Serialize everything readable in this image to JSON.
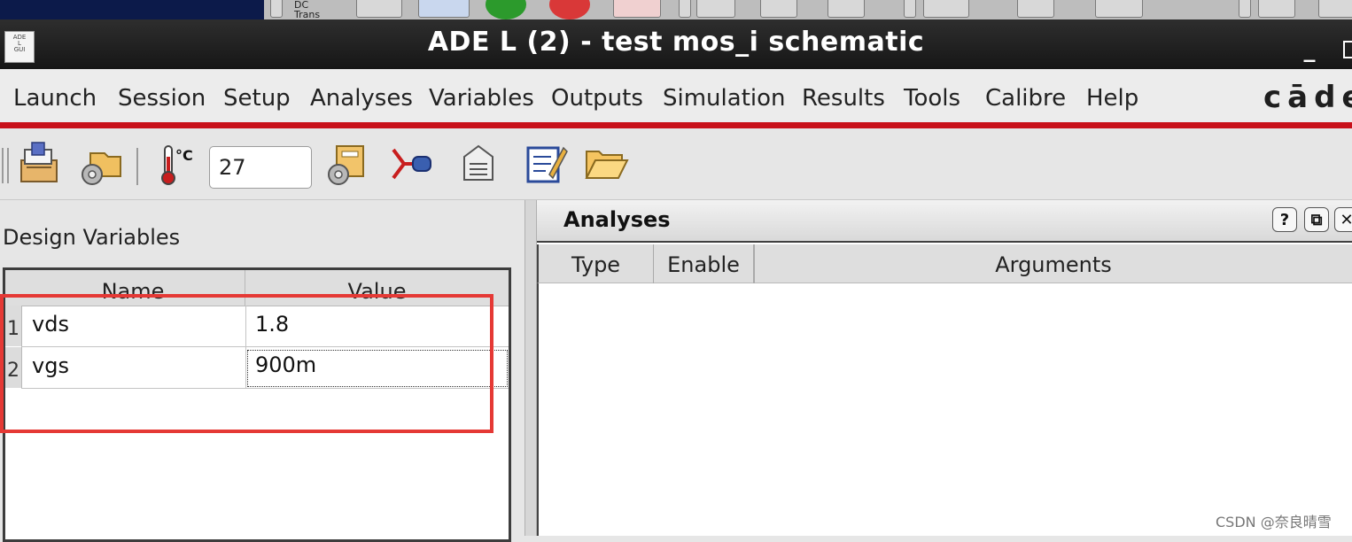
{
  "window": {
    "app_icon_text": "ADE\nL\nGUI",
    "title": "ADE L (2) - test mos_i schematic"
  },
  "top_strip": {
    "partial_label": "DC\nTrans"
  },
  "menu": {
    "items": [
      {
        "label": "Launch"
      },
      {
        "label": "Session"
      },
      {
        "label": "Setup"
      },
      {
        "label": "Analyses"
      },
      {
        "label": "Variables"
      },
      {
        "label": "Outputs"
      },
      {
        "label": "Simulation"
      },
      {
        "label": "Results"
      },
      {
        "label": "Tools"
      },
      {
        "label": "Calibre"
      },
      {
        "label": "Help"
      }
    ],
    "brand": "cāde"
  },
  "toolbar": {
    "temperature_unit": "°C",
    "temperature_value": "27",
    "icons": [
      "save-state-icon",
      "load-setup-icon",
      "thermometer-icon",
      "setup-model-icon",
      "choose-analyses-icon",
      "edit-variables-icon",
      "edit-outputs-icon",
      "open-folder-icon"
    ]
  },
  "design_variables": {
    "title": "Design Variables",
    "columns": [
      "Name",
      "Value"
    ],
    "rows": [
      {
        "index": "1",
        "name": "vds",
        "value": "1.8"
      },
      {
        "index": "2",
        "name": "vgs",
        "value": "900m"
      }
    ]
  },
  "analyses": {
    "title": "Analyses",
    "buttons": [
      "?",
      "⧉",
      "✕"
    ],
    "columns": [
      "Type",
      "Enable",
      "Arguments"
    ]
  },
  "watermark": "CSDN @奈良晴雪",
  "colors": {
    "menu_underline": "#c8101a",
    "highlight_box": "#e53935",
    "titlebar": "#1e1e1e"
  }
}
